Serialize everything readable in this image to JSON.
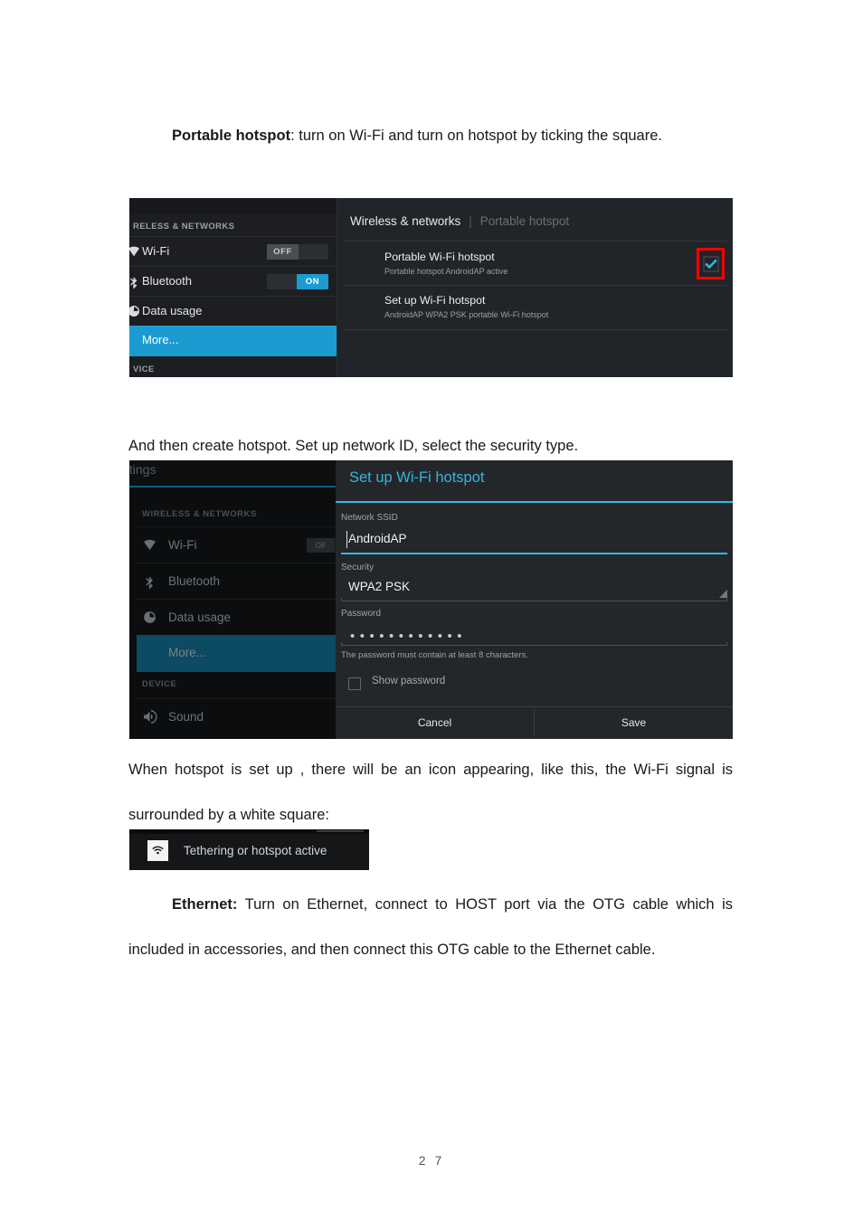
{
  "document": {
    "page_number": "2 7",
    "paragraphs": {
      "p1_bold": "Portable hotspot",
      "p1_rest": ": turn on Wi-Fi and turn on hotspot by ticking the square.",
      "p2": "And then create hotspot. Set up network ID, select the security type.",
      "p3": "When hotspot is set up , there will be an icon appearing, like this, the Wi-Fi signal is surrounded by a white square:",
      "p4_bold": "Ethernet:",
      "p4_rest": " Turn on Ethernet, connect to HOST port via the OTG cable which is included in accessories, and then connect this OTG cable to the Ethernet cable."
    }
  },
  "screenshot_hotspot": {
    "sidebar": {
      "section_header": "RELESS & NETWORKS",
      "section_footer": "VICE",
      "items": [
        {
          "label": "Wi-Fi",
          "icon": "wifi-icon",
          "toggle_state": "OFF"
        },
        {
          "label": "Bluetooth",
          "icon": "bluetooth-icon",
          "toggle_state": "ON"
        },
        {
          "label": "Data usage",
          "icon": "data-usage-icon",
          "toggle_state": ""
        },
        {
          "label": "More...",
          "icon": "",
          "toggle_state": ""
        }
      ]
    },
    "breadcrumb": {
      "parent": "Wireless & networks",
      "current": "Portable hotspot"
    },
    "rows": [
      {
        "title": "Portable Wi-Fi hotspot",
        "subtitle": "Portable hotspot AndroidAP active",
        "checked": true
      },
      {
        "title": "Set up Wi-Fi hotspot",
        "subtitle": "AndroidAP WPA2 PSK portable Wi-Fi hotspot",
        "checked": false
      }
    ],
    "highlight_color": "#ff0000",
    "accent_color": "#1b9bd0"
  },
  "screenshot_setup": {
    "action_bar_title": "ttings",
    "sidebar": {
      "section_header": "WIRELESS & NETWORKS",
      "section_header_2": "DEVICE",
      "items": [
        {
          "label": "Wi-Fi",
          "icon": "wifi-icon",
          "toggle_state": "OF"
        },
        {
          "label": "Bluetooth",
          "icon": "bluetooth-icon",
          "toggle_state": ""
        },
        {
          "label": "Data usage",
          "icon": "data-usage-icon",
          "toggle_state": ""
        },
        {
          "label": "More...",
          "icon": "",
          "toggle_state": ""
        },
        {
          "label": "Sound",
          "icon": "sound-icon",
          "toggle_state": ""
        }
      ]
    },
    "dialog": {
      "title": "Set up Wi-Fi hotspot",
      "ssid_label": "Network SSID",
      "ssid_value": "AndroidAP",
      "security_label": "Security",
      "security_value": "WPA2 PSK",
      "password_label": "Password",
      "password_value": "••••••••••••",
      "password_hint": "The password must contain at least 8 characters.",
      "show_password_label": "Show password",
      "show_password_checked": false,
      "cancel_label": "Cancel",
      "save_label": "Save"
    },
    "accent_color": "#33b5e5"
  },
  "screenshot_notification": {
    "text": "Tethering or hotspot active",
    "icon": "wifi-tethering-icon"
  }
}
